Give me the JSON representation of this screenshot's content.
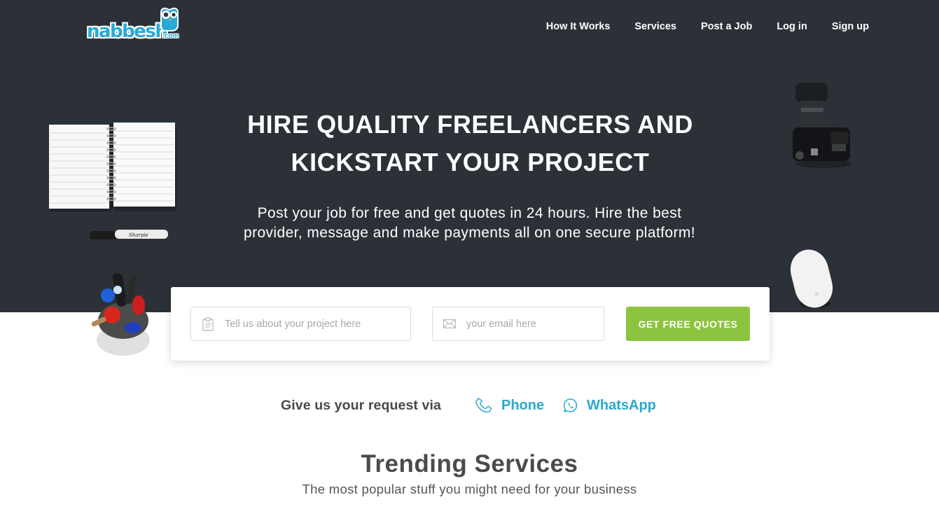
{
  "brand": {
    "name": "nabbesh",
    "tld": ".com",
    "color": "#2aa9d6"
  },
  "nav": {
    "items": [
      {
        "label": "How It Works"
      },
      {
        "label": "Services"
      },
      {
        "label": "Post a Job"
      },
      {
        "label": "Log in"
      },
      {
        "label": "Sign up"
      }
    ]
  },
  "hero": {
    "headline_lines": [
      "HIRE QUALITY FREELANCERS AND",
      "KICKSTART YOUR PROJECT"
    ],
    "subline_lines": [
      "Post your job for free and get quotes in 24 hours. Hire the best",
      "provider, message and make payments all on one secure platform!"
    ],
    "background": "#2b3137",
    "decorations": [
      "notebook",
      "marker",
      "camera",
      "mouse",
      "pen-holder"
    ]
  },
  "form": {
    "project_placeholder": "Tell us about your project here",
    "project_value": "",
    "project_icon": "clipboard-icon",
    "email_placeholder": "your email here",
    "email_value": "",
    "email_icon": "envelope-icon",
    "submit_label": "GET FREE QUOTES",
    "submit_color": "#8cc43f"
  },
  "contact": {
    "label": "Give us your request via",
    "phone_label": "Phone",
    "phone_icon": "phone-icon",
    "whatsapp_label": "WhatsApp",
    "whatsapp_icon": "whatsapp-icon",
    "link_color": "#2aa9cf"
  },
  "trending": {
    "title": "Trending Services",
    "subtitle": "The most popular stuff you might need for your business"
  }
}
